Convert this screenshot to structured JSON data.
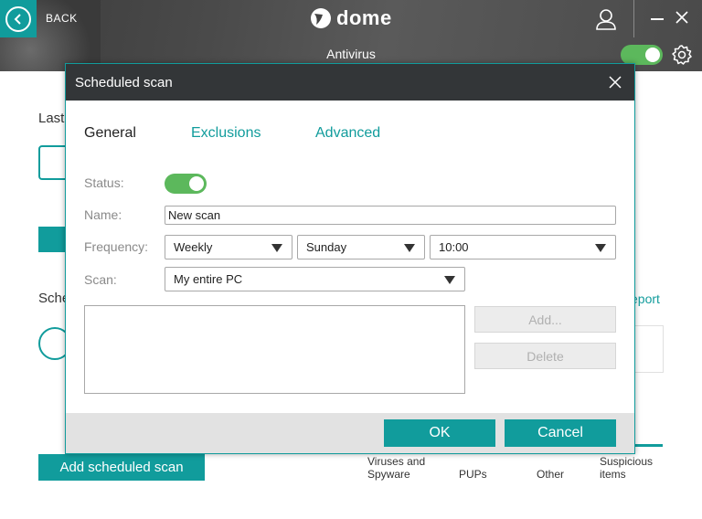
{
  "header": {
    "back_label": "BACK",
    "logo_text": "dome",
    "section_title": "Antivirus",
    "antivirus_enabled": true
  },
  "background": {
    "last_scan_partial": "Last",
    "scheduled_partial": "Sche",
    "report_partial": "eport",
    "add_scheduled_button": "Add scheduled scan",
    "categories": [
      {
        "label1": "Viruses and",
        "label2": "Spyware"
      },
      {
        "label1": "PUPs",
        "label2": ""
      },
      {
        "label1": "Other",
        "label2": ""
      },
      {
        "label1": "Suspicious",
        "label2": "items"
      }
    ]
  },
  "dialog": {
    "title": "Scheduled scan",
    "tabs": [
      "General",
      "Exclusions",
      "Advanced"
    ],
    "active_tab": "General",
    "fields": {
      "status_label": "Status:",
      "status_enabled": true,
      "name_label": "Name:",
      "name_value": "New scan",
      "frequency_label": "Frequency:",
      "frequency_value": "Weekly",
      "day_value": "Sunday",
      "time_value": "10:00",
      "scan_label": "Scan:",
      "scan_value": "My entire PC"
    },
    "add_button": "Add...",
    "delete_button": "Delete",
    "ok_button": "OK",
    "cancel_button": "Cancel"
  },
  "colors": {
    "accent": "#119c9c",
    "toggle_on": "#5cb85c",
    "header_dark": "#333638"
  }
}
